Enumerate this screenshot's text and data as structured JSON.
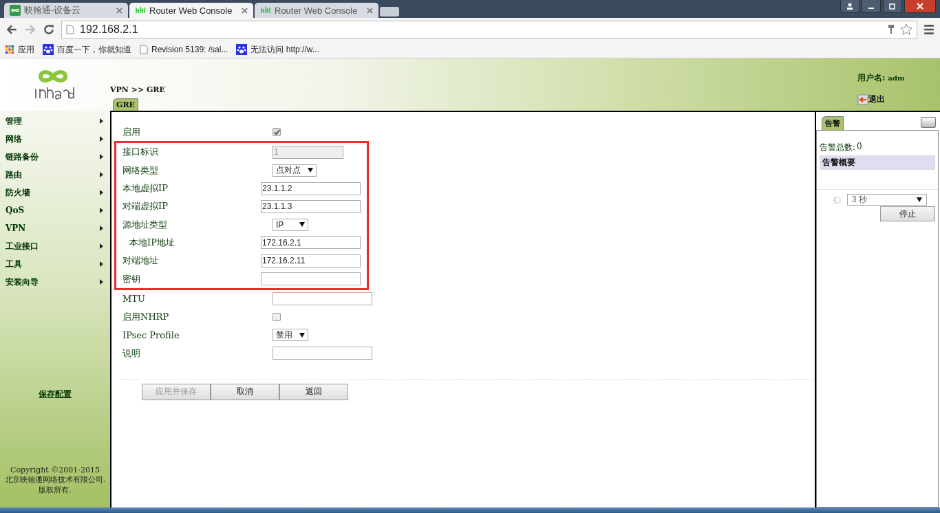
{
  "browser": {
    "tabs": [
      {
        "title": "映翰通-设备云",
        "kind": "cloud",
        "selected": false
      },
      {
        "title": "Router Web Console",
        "kind": "router",
        "selected": true
      },
      {
        "title": "Router Web Console",
        "kind": "router",
        "selected": false
      }
    ],
    "address": "192.168.2.1",
    "bookmarks": [
      {
        "label": "应用",
        "kind": "apps"
      },
      {
        "label": "百度一下，你就知道",
        "kind": "paw"
      },
      {
        "label": "Revision 5139: /sal...",
        "kind": "page"
      },
      {
        "label": "无法访问 http://w...",
        "kind": "paw"
      }
    ]
  },
  "header": {
    "breadcrumb": "VPN >> GRE",
    "tabs": [
      {
        "label": "GRE",
        "selected": true
      }
    ],
    "user_label": "用户名:",
    "user": "adm",
    "logout": "退出"
  },
  "sidebar": {
    "items": [
      {
        "label": "管理"
      },
      {
        "label": "网络"
      },
      {
        "label": "链路备份"
      },
      {
        "label": "路由"
      },
      {
        "label": "防火墙"
      },
      {
        "label": "QoS"
      },
      {
        "label": "VPN"
      },
      {
        "label": "工业接口"
      },
      {
        "label": "工具"
      },
      {
        "label": "安装向导"
      }
    ],
    "save_link": "保存配置",
    "copyright": [
      "Copyright ©2001-2015",
      "北京映翰通网络技术有限公司.",
      "版权所有."
    ]
  },
  "form": {
    "sections": [
      {
        "highlighted": false,
        "rows": [
          {
            "label": "启用",
            "kind": "checkbox",
            "checked": true
          }
        ]
      },
      {
        "highlighted": true,
        "rows": [
          {
            "label": "接口标识",
            "kind": "text",
            "value": "1",
            "disabled": true
          },
          {
            "label": "网络类型",
            "kind": "select",
            "value": "点对点"
          },
          {
            "label": "本地虚拟IP",
            "kind": "text",
            "value": "23.1.1.2"
          },
          {
            "label": "对端虚拟IP",
            "kind": "text",
            "value": "23.1.1.3"
          },
          {
            "label": "源地址类型",
            "kind": "select",
            "value": "IP"
          },
          {
            "label": "本地IP地址",
            "kind": "text",
            "value": "172.16.2.1",
            "indent": true
          },
          {
            "label": "对端地址",
            "kind": "text",
            "value": "172.16.2.11"
          },
          {
            "label": "密钥",
            "kind": "text",
            "value": ""
          }
        ]
      },
      {
        "highlighted": false,
        "rows": [
          {
            "label": "MTU",
            "kind": "text",
            "value": ""
          },
          {
            "label": "启用NHRP",
            "kind": "checkbox",
            "checked": false
          },
          {
            "label": "IPsec Profile",
            "kind": "select",
            "value": "禁用"
          },
          {
            "label": "说明",
            "kind": "text",
            "value": ""
          }
        ]
      }
    ],
    "buttons": [
      {
        "label": "应用并保存",
        "disabled": true
      },
      {
        "label": "取消",
        "disabled": false
      },
      {
        "label": "返回",
        "disabled": false
      }
    ]
  },
  "alarm": {
    "tabs": [
      {
        "label": "告警",
        "selected": true
      }
    ],
    "total_label": "告警总数:",
    "total": "0",
    "summary": "告警概要",
    "refresh": "3 秒",
    "stop": "停止"
  }
}
